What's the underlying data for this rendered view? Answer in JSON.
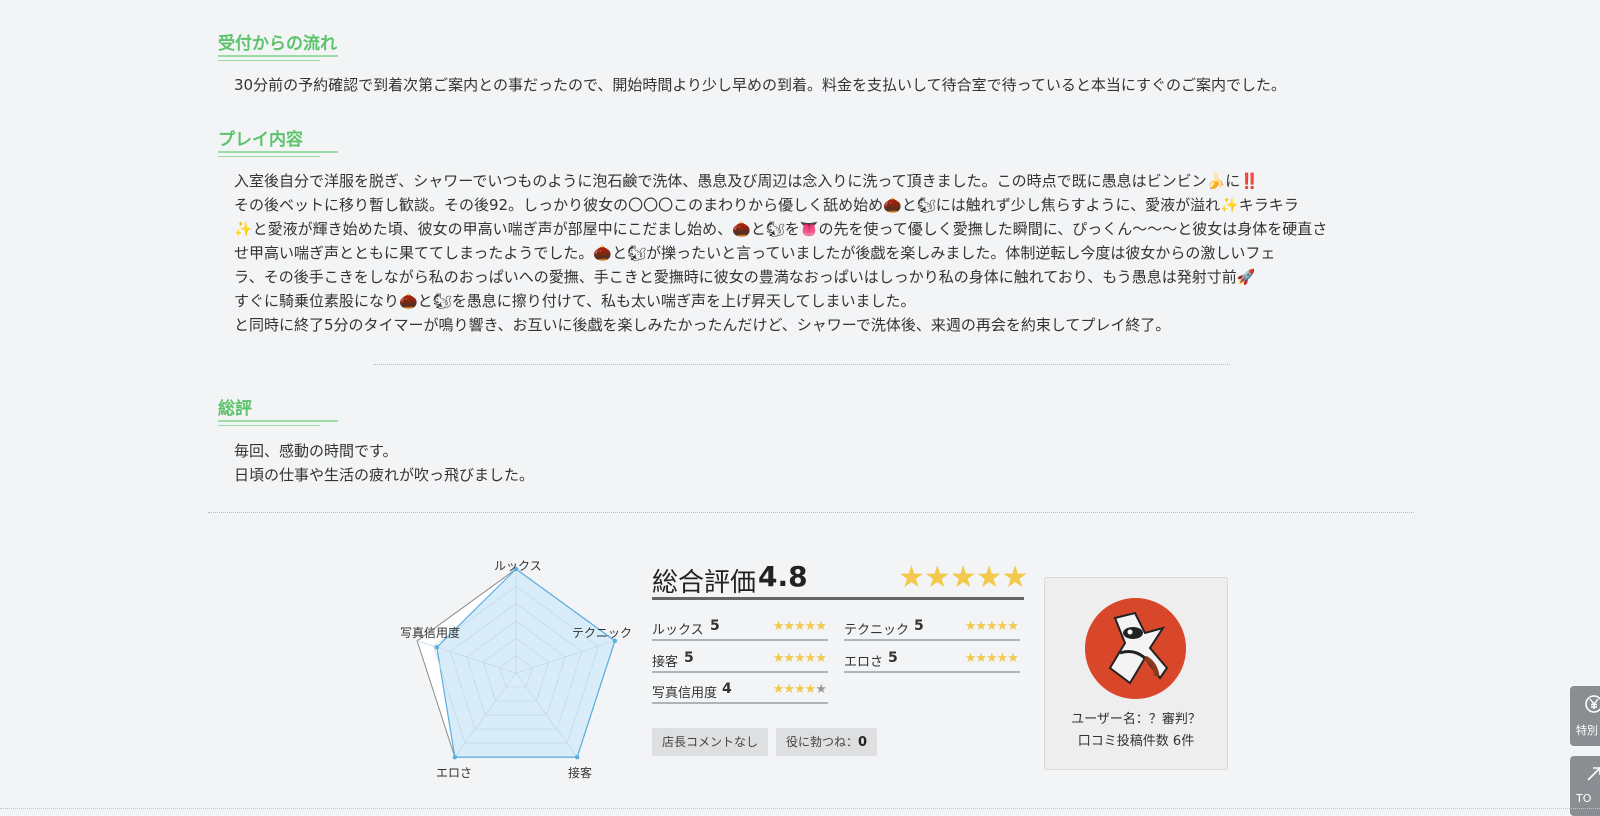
{
  "sections": {
    "flow": {
      "heading": "受付からの流れ",
      "lines": [
        "30分前の予約確認で到着次第ご案内との事だったので、開始時間より少し早めの到着。料金を支払いして待合室で待っていると本当にすぐのご案内でした。"
      ]
    },
    "play": {
      "heading": "プレイ内容",
      "lines": [
        "入室後自分で洋服を脱ぎ、シャワーでいつものように泡石鹸で洗体、愚息及び周辺は念入りに洗って頂きました。この時点で既に愚息はビンビン🍌に‼️",
        "その後ベットに移り暫し歓談。その後92。しっかり彼女の〇〇〇このまわりから優しく舐め始め🌰と🐿には触れず少し焦らすように、愛液が溢れ✨キラキラ",
        "✨と愛液が輝き始めた頃、彼女の甲高い喘ぎ声が部屋中にこだまし始め、🌰と🐿を👅の先を使って優しく愛撫した瞬間に、ぴっくん〜〜〜と彼女は身体を硬直さ",
        "せ甲高い喘ぎ声とともに果ててしまったようでした。🌰と🐿が擽ったいと言っていましたが後戯を楽しみました。体制逆転し今度は彼女からの激しいフェ",
        "ラ、その後手こきをしながら私のおっぱいへの愛撫、手こきと愛撫時に彼女の豊満なおっぱいはしっかり私の身体に触れており、もう愚息は発射寸前🚀",
        "すぐに騎乗位素股になり🌰と🐿を愚息に擦り付けて、私も太い喘ぎ声を上げ昇天してしまいました。",
        "と同時に終了5分のタイマーが鳴り響き、お互いに後戯を楽しみたかったんだけど、シャワーで洗体後、来週の再会を約束してプレイ終了。"
      ]
    },
    "summary": {
      "heading": "総評",
      "lines": [
        "毎回、感動の時間です。",
        "日頃の仕事や生活の疲れが吹っ飛びました。"
      ]
    }
  },
  "radar": {
    "labels": [
      "ルックス",
      "テクニック",
      "接客",
      "エロさ",
      "写真信用度"
    ],
    "values": [
      5,
      5,
      5,
      5,
      4
    ],
    "max": 5,
    "fill_color": "#d8ecf9",
    "stroke_color": "#5aaee0"
  },
  "rating": {
    "overall_label": "総合評価",
    "overall_score": "4.8",
    "overall_stars": "★★★★★",
    "star_color": "#f2c94c",
    "categories": [
      {
        "name": "ルックス",
        "score": "5",
        "on": "★★★★★",
        "off": ""
      },
      {
        "name": "テクニック",
        "score": "5",
        "on": "★★★★★",
        "off": ""
      },
      {
        "name": "接客",
        "score": "5",
        "on": "★★★★★",
        "off": ""
      },
      {
        "name": "エロさ",
        "score": "5",
        "on": "★★★★★",
        "off": ""
      },
      {
        "name": "写真信用度",
        "score": "4",
        "on": "★★★★",
        "off": "★"
      }
    ],
    "tags": {
      "manager_comment": "店長コメントなし",
      "helpful_label": "役に勃つね：",
      "helpful_count": "0"
    }
  },
  "user": {
    "name": "ユーザー名：？審判？",
    "post_count": "口コミ投稿件数 6件"
  },
  "side_buttons": [
    {
      "icon": "yen-circle-icon",
      "label": "特別"
    },
    {
      "icon": "arrow-up-icon",
      "label": "TO"
    }
  ]
}
